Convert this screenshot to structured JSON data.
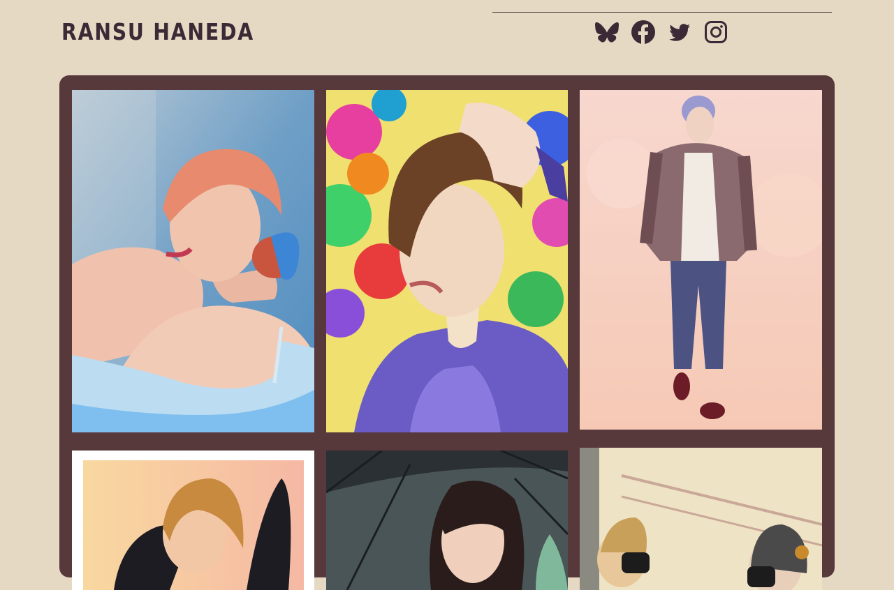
{
  "site": {
    "title": "RANSU HANEDA"
  },
  "social": [
    {
      "name": "bluesky-icon"
    },
    {
      "name": "facebook-icon"
    },
    {
      "name": "twitter-icon"
    },
    {
      "name": "instagram-icon"
    }
  ],
  "colors": {
    "background": "#e6d9c4",
    "gallery_bg": "#57393b",
    "ink": "#3a2a35"
  }
}
